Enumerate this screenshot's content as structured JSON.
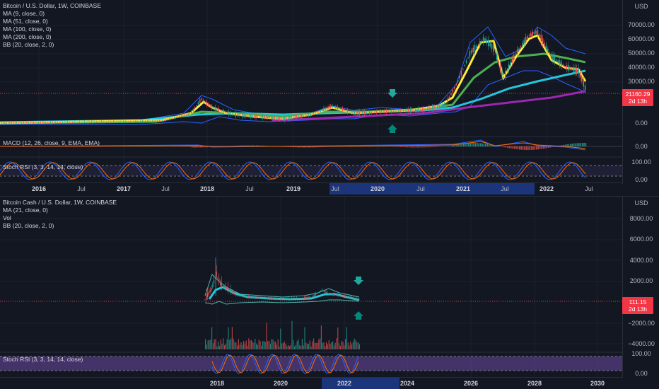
{
  "top": {
    "legend": [
      "Bitcoin / U.S. Dollar, 1W, COINBASE",
      "MA (9, close, 0)",
      "MA (51, close, 0)",
      "MA (100, close, 0)",
      "MA (200, close, 0)",
      "BB (20, close, 2, 0)"
    ],
    "currency": "USD",
    "price_labels": [
      "70000.00",
      "60000.00",
      "50000.00",
      "40000.00",
      "30000.00",
      "0.00"
    ],
    "price_tag": {
      "value": "21160.29",
      "countdown": "2d 13h"
    },
    "macd_label": "MACD (12, 26, close, 9, EMA, EMA)",
    "macd_axis": "0.00",
    "stoch_label": "Stoch RSI (3, 3, 14, 14, close)",
    "stoch_axis": [
      "100.00",
      "0.00"
    ],
    "time_labels": [
      "2016",
      "Jul",
      "2017",
      "Jul",
      "2018",
      "Jul",
      "2019",
      "Jul",
      "2020",
      "Jul",
      "2021",
      "Jul",
      "2022",
      "Jul"
    ]
  },
  "bottom": {
    "legend": [
      "Bitcoin Cash / U.S. Dollar, 1W, COINBASE",
      "MA (21, close, 0)",
      "Vol",
      "BB (20, close, 2, 0)"
    ],
    "currency": "USD",
    "price_labels": [
      "8000.00",
      "6000.00",
      "4000.00",
      "2000.00",
      "−2000.00",
      "−4000.00"
    ],
    "price_tag": {
      "value": "111.15",
      "countdown": "2d 13h"
    },
    "stoch_label": "Stoch RSI (3, 3, 14, 14, close)",
    "stoch_axis": [
      "100.00",
      "0.00"
    ],
    "time_labels": [
      "2018",
      "2020",
      "2022",
      "2024",
      "2026",
      "2028",
      "2030"
    ]
  },
  "colors": {
    "bg": "#131722",
    "up": "#26a69a",
    "down": "#ef5350",
    "ma9": "#ffeb3b",
    "ma51": "#4caf50",
    "ma100": "#26c6da",
    "ma200": "#9c27b0",
    "bb": "#2962ff",
    "stoch_k": "#2962ff",
    "stoch_d": "#ff6d00",
    "arrow_down": "#26a69a",
    "arrow_up": "#00897b"
  }
}
